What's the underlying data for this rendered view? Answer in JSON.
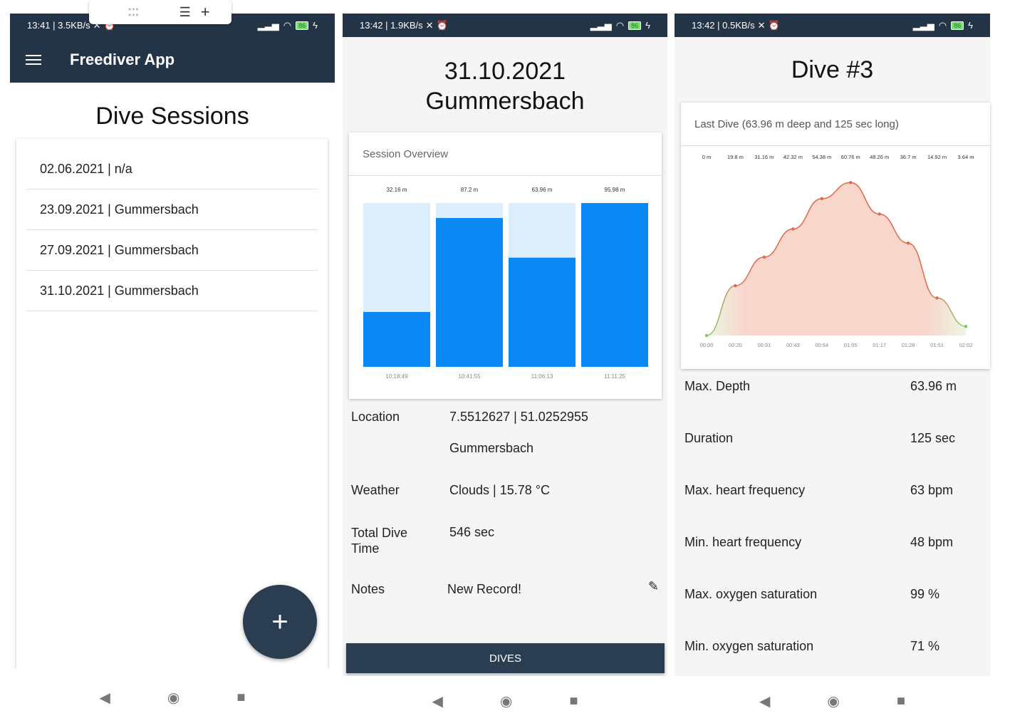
{
  "phone1": {
    "status": {
      "time": "13:41 | 3.5KB/s",
      "battery": "86"
    },
    "appbar_title": "Freediver App",
    "page_title": "Dive Sessions",
    "sessions": [
      "02.06.2021 | n/a",
      "23.09.2021 | Gummersbach",
      "27.09.2021 | Gummersbach",
      "31.10.2021 | Gummersbach"
    ],
    "fab_icon": "plus-icon"
  },
  "phone2": {
    "status": {
      "time": "13:42 | 1.9KB/s",
      "battery": "86"
    },
    "title_line1": "31.10.2021",
    "title_line2": "Gummersbach",
    "card_title": "Session Overview",
    "location_label": "Location",
    "location_coords": "7.5512627 | 51.0252955",
    "location_name": "Gummersbach",
    "weather_label": "Weather",
    "weather_value": "Clouds | 15.78 °C",
    "total_label": "Total Dive Time",
    "total_value": "546 sec",
    "notes_label": "Notes",
    "notes_value": "New Record!",
    "dives_button": "DIVES"
  },
  "phone3": {
    "status": {
      "time": "13:42 | 0.5KB/s",
      "battery": "86"
    },
    "title": "Dive #3",
    "card_title": "Last Dive (63.96 m deep and 125 sec long)",
    "stats": [
      {
        "label": "Max. Depth",
        "value": "63.96 m"
      },
      {
        "label": "Duration",
        "value": "125 sec"
      },
      {
        "label": "Max. heart frequency",
        "value": "63 bpm"
      },
      {
        "label": "Min. heart frequency",
        "value": "48 bpm"
      },
      {
        "label": "Max. oxygen saturation",
        "value": "99 %"
      },
      {
        "label": "Min. oxygen saturation",
        "value": "71 %"
      }
    ]
  },
  "chart_data": [
    {
      "type": "bar",
      "title": "Session Overview",
      "categories": [
        "10:18:49",
        "10:41:55",
        "11:06:13",
        "11:11:25"
      ],
      "labels": [
        "32.16 m",
        "87.2 m",
        "63.96 m",
        "95.98 m"
      ],
      "values": [
        32.16,
        87.2,
        63.96,
        95.98
      ],
      "ylim": [
        0,
        95.98
      ],
      "bar_color": "#0a89f5",
      "background_color": "#dcedfb"
    },
    {
      "type": "area",
      "title": "Last Dive (63.96 m deep and 125 sec long)",
      "x": [
        "00:00",
        "00:20",
        "00:31",
        "00:43",
        "00:54",
        "01:05",
        "01:17",
        "01:28",
        "01:51",
        "02:02"
      ],
      "point_labels": [
        "0 m",
        "19.8 m",
        "31.16 m",
        "42.32 m",
        "54.38 m",
        "60.76 m",
        "48.26 m",
        "36.7 m",
        "14.92 m",
        "3.64 m"
      ],
      "values": [
        0,
        19.8,
        31.16,
        42.32,
        54.38,
        60.76,
        48.26,
        36.7,
        14.92,
        3.64
      ],
      "ylim": [
        0,
        63.96
      ],
      "line_color": "#e0694a",
      "fill_color": "#f9d6cc"
    }
  ]
}
